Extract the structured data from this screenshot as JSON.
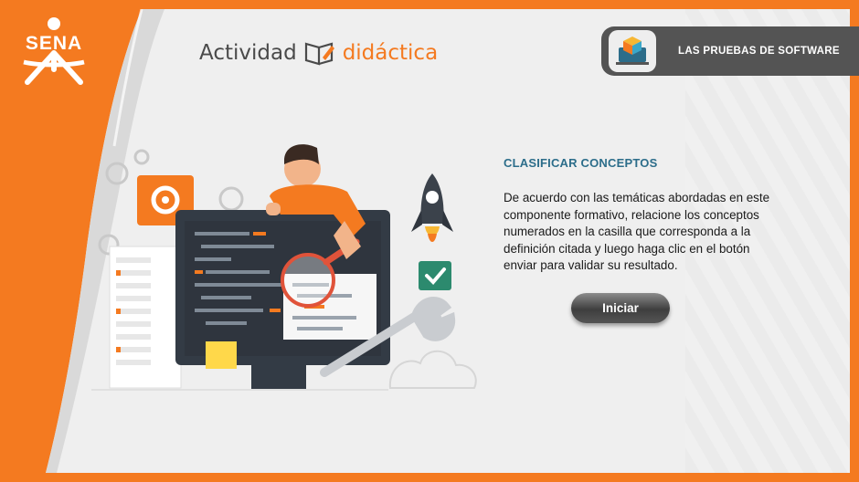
{
  "logo": {
    "text": "SENA"
  },
  "brand": {
    "left": "Actividad",
    "right": "didáctica"
  },
  "topic": {
    "label": "LAS PRUEBAS DE SOFTWARE"
  },
  "activity": {
    "title": "CLASIFICAR CONCEPTOS",
    "description": "De acuerdo con las temáticas abordadas en este componente formativo, relacione los conceptos numerados en la casilla que corresponda a la definición citada y luego haga clic en el botón enviar para validar su resultado.",
    "start_label": "Iniciar"
  },
  "colors": {
    "accent": "#f47a20",
    "title": "#2c6d8a",
    "bar": "#545454"
  }
}
